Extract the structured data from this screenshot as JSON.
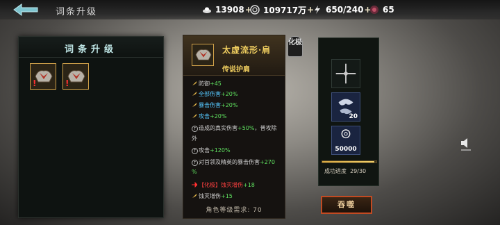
{
  "header": {
    "title": "词条升级",
    "resources": [
      {
        "name": "coins",
        "value": "13908",
        "icon": "ingot-icon"
      },
      {
        "name": "jade",
        "value": "109717万",
        "icon": "coin-ring-icon"
      },
      {
        "name": "stamina",
        "value": "650/240",
        "icon": "lightning-icon"
      },
      {
        "name": "gems",
        "value": "65",
        "icon": "gem-icon"
      }
    ]
  },
  "left_panel": {
    "title": "词条升级",
    "items": [
      {
        "icon": "shoulder-armor-icon",
        "warning": "!"
      },
      {
        "icon": "shoulder-armor-icon",
        "warning": "!"
      }
    ]
  },
  "item_detail": {
    "name": "太虚流形·肩",
    "quality": "传说护肩",
    "grade_badge": "化极",
    "attributes": [
      {
        "label": "防御",
        "value": "+45"
      },
      {
        "label": "全部伤害",
        "value": "+20%"
      },
      {
        "label": "暴击伤害",
        "value": "+20%"
      },
      {
        "label": "攻击",
        "value": "+20%"
      }
    ],
    "specials": [
      {
        "label": "造成的真实伤害",
        "value": "+50%",
        "suffix": "，普攻除",
        "suffix2": "外"
      },
      {
        "label": "攻击",
        "value": "+120%"
      },
      {
        "label": "对首领及精英的暴击伤害",
        "value": "+270",
        "suffix2": "%"
      }
    ],
    "set_bonus": {
      "label": "【化极】蚀灭增伤",
      "value": "+18"
    },
    "extra": {
      "label": "蚀灭增伤",
      "value": "+15"
    },
    "requirement": "角色等级需求: 70"
  },
  "right_panel": {
    "material_count": "20",
    "coin_cost": "50000",
    "progress": {
      "label": "成功进度",
      "value": "29/30",
      "fraction": 0.9667
    },
    "devour_label": "吞噬"
  },
  "colors": {
    "gold": "#f2d060",
    "green": "#5fe05f",
    "cyan": "#55c8ff",
    "red": "#ff4040",
    "button_border": "#c24a22"
  }
}
